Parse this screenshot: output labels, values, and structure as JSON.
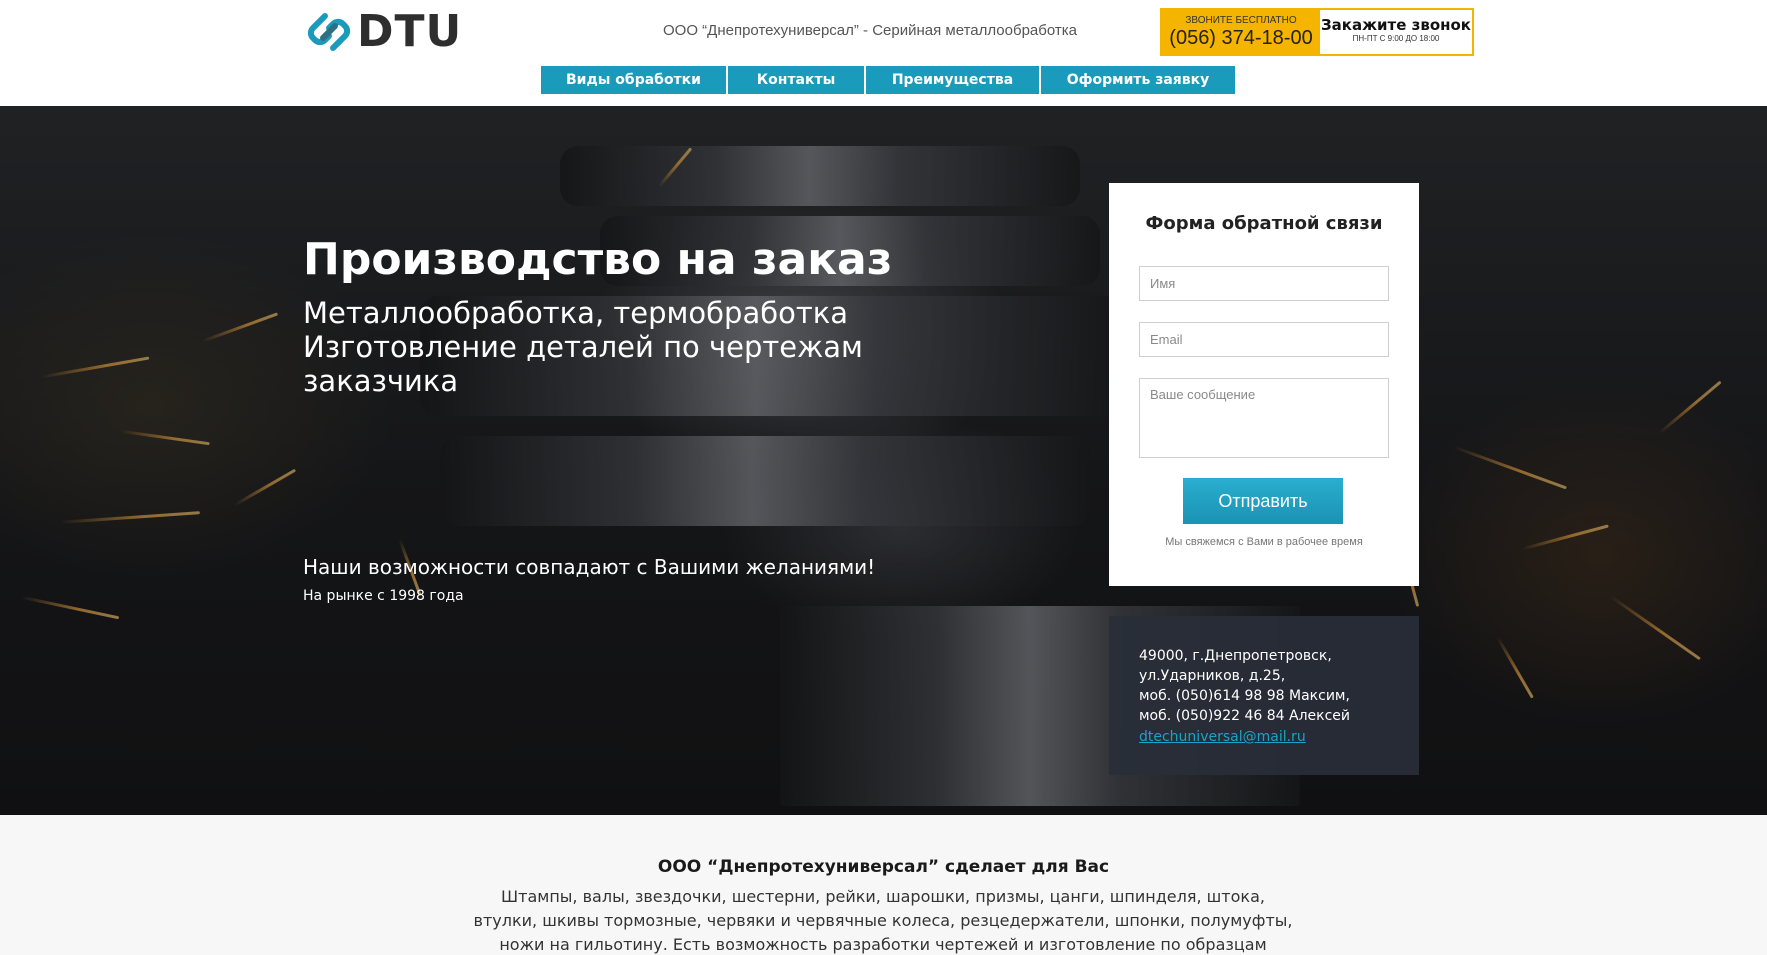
{
  "header": {
    "logo_text": "DTU",
    "logo_icon": "chain-link-icon",
    "tagline": "ООО “Днепротехуниверсал” - Серийная металлообработка",
    "call": {
      "free_label": "ЗВОНИТЕ БЕСПЛАТНО",
      "phone": "(056) 374-18-00",
      "cta": "Закажите звонок",
      "hours": "ПН-ПТ С 9:00 ДО 18:00"
    }
  },
  "nav": {
    "items": [
      {
        "label": "Виды обработки"
      },
      {
        "label": "Контакты"
      },
      {
        "label": "Преимущества"
      },
      {
        "label": "Оформить заявку"
      }
    ]
  },
  "hero": {
    "title": "Производство на заказ",
    "subtitle_lines": [
      "Металлообработка, термобработка",
      "Изготовление деталей по чертежам",
      "заказчика"
    ],
    "slogan": "Наши возможности совпадают с Вашими желаниями!",
    "since": "На рынке с 1998 года"
  },
  "form": {
    "title": "Форма обратной связи",
    "name_placeholder": "Имя",
    "email_placeholder": "Email",
    "message_placeholder": "Ваше сообщение",
    "submit_label": "Отправить",
    "note": "Мы свяжемся с Вами в рабочее время"
  },
  "contact": {
    "lines": [
      "49000, г.Днепропетровск,",
      "ул.Ударников, д.25,",
      "моб. (050)614 98 98 Максим,",
      "моб. (050)922 46 84 Алексей"
    ],
    "email": "dtechuniversal@mail.ru"
  },
  "about": {
    "title": "ООО “Днепротехуниверсал” сделает для Вас",
    "text": "Штампы, валы, звездочки, шестерни, рейки, шарошки, призмы, цанги, шпинделя, штока, втулки, шкивы тормозные, червяки и червячные колеса, резцедержатели, шпонки, полумуфты, ножи на гильотину. Есть возможность разработки чертежей и изготовление по образцам заказчика."
  },
  "colors": {
    "accent": "#1a9bbb",
    "call_yellow": "#f5b400",
    "contact_bg": "#282e38"
  }
}
